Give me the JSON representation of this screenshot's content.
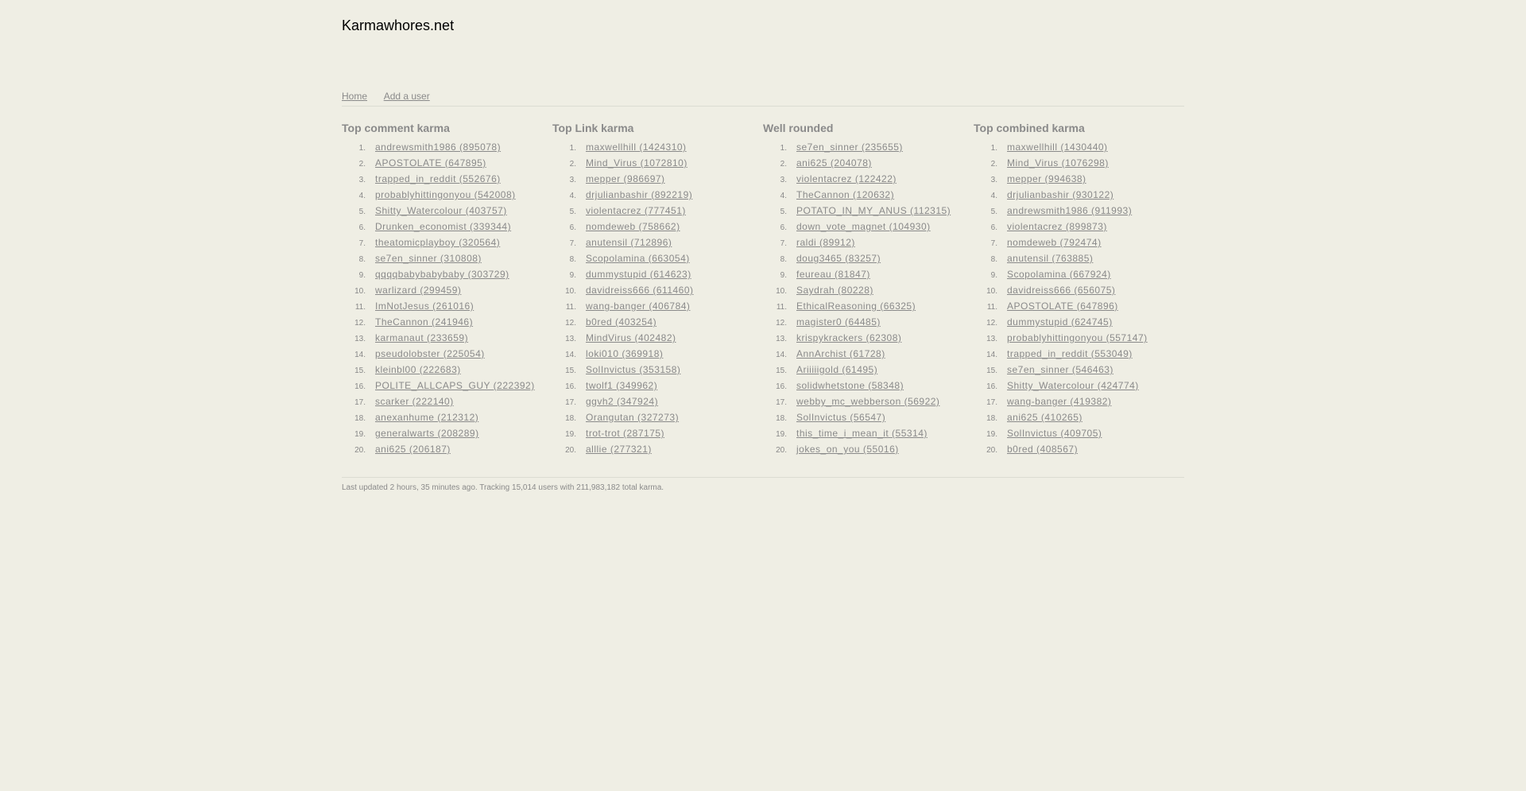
{
  "site": {
    "title": "Karmawhores.net"
  },
  "nav": {
    "home": "Home",
    "add_user": "Add a user"
  },
  "columns": [
    {
      "title": "Top comment karma",
      "items": [
        "andrewsmith1986 (895078)",
        "APOSTOLATE (647895)",
        "trapped_in_reddit (552676)",
        "probablyhittingonyou (542008)",
        "Shitty_Watercolour (403757)",
        "Drunken_economist (339344)",
        "theatomicplayboy (320564)",
        "se7en_sinner (310808)",
        "qqqqbabybabybaby (303729)",
        "warlizard (299459)",
        "ImNotJesus (261016)",
        "TheCannon (241946)",
        "karmanaut (233659)",
        "pseudolobster (225054)",
        "kleinbl00 (222683)",
        "POLITE_ALLCAPS_GUY (222392)",
        "scarker (222140)",
        "anexanhume (212312)",
        "generalwarts (208289)",
        "ani625 (206187)"
      ]
    },
    {
      "title": "Top Link karma",
      "items": [
        "maxwellhill (1424310)",
        "Mind_Virus (1072810)",
        "mepper (986697)",
        "drjulianbashir (892219)",
        "violentacrez (777451)",
        "nomdeweb (758662)",
        "anutensil (712896)",
        "Scopolamina (663054)",
        "dummystupid (614623)",
        "davidreiss666 (611460)",
        "wang-banger (406784)",
        "b0red (403254)",
        "MindVirus (402482)",
        "loki010 (369918)",
        "SolInvictus (353158)",
        "twolf1 (349962)",
        "ggvh2 (347924)",
        "Orangutan (327273)",
        "trot-trot (287175)",
        "alllie (277321)"
      ]
    },
    {
      "title": "Well rounded",
      "items": [
        "se7en_sinner (235655)",
        "ani625 (204078)",
        "violentacrez (122422)",
        "TheCannon (120632)",
        "POTATO_IN_MY_ANUS (112315)",
        "down_vote_magnet (104930)",
        "raldi (89912)",
        "doug3465 (83257)",
        "feureau (81847)",
        "Saydrah (80228)",
        "EthicalReasoning (66325)",
        "magister0 (64485)",
        "krispykrackers (62308)",
        "AnnArchist (61728)",
        "Ariiiiigold (61495)",
        "solidwhetstone (58348)",
        "webby_mc_webberson (56922)",
        "SolInvictus (56547)",
        "this_time_i_mean_it (55314)",
        "jokes_on_you (55016)"
      ]
    },
    {
      "title": "Top combined karma",
      "items": [
        "maxwellhill (1430440)",
        "Mind_Virus (1076298)",
        "mepper (994638)",
        "drjulianbashir (930122)",
        "andrewsmith1986 (911993)",
        "violentacrez (899873)",
        "nomdeweb (792474)",
        "anutensil (763885)",
        "Scopolamina (667924)",
        "davidreiss666 (656075)",
        "APOSTOLATE (647896)",
        "dummystupid (624745)",
        "probablyhittingonyou (557147)",
        "trapped_in_reddit (553049)",
        "se7en_sinner (546463)",
        "Shitty_Watercolour (424774)",
        "wang-banger (419382)",
        "ani625 (410265)",
        "SolInvictus (409705)",
        "b0red (408567)"
      ]
    }
  ],
  "footer": {
    "text": "Last updated 2 hours, 35 minutes ago. Tracking 15,014 users with 211,983,182 total karma."
  }
}
